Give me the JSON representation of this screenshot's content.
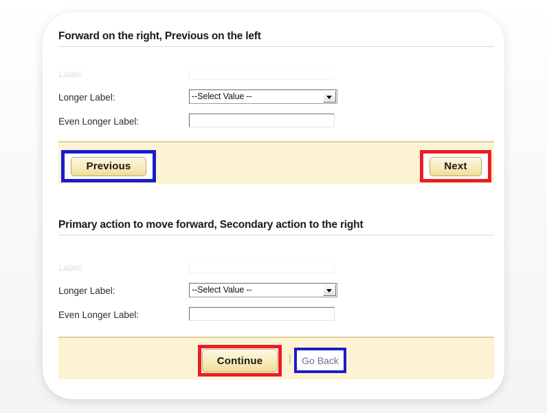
{
  "sections": [
    {
      "heading": "Forward on the right, Previous on the left",
      "fields": [
        {
          "label": "Label:",
          "type": "text",
          "value": "",
          "faded": true
        },
        {
          "label": "Longer Label:",
          "type": "select",
          "value": "--Select Value --"
        },
        {
          "label": "Even Longer Label:",
          "type": "text",
          "value": ""
        }
      ],
      "actions": {
        "left_button": "Previous",
        "right_button": "Next",
        "left_highlight": "blue",
        "right_highlight": "red"
      }
    },
    {
      "heading": "Primary action to move forward, Secondary action to the right",
      "fields": [
        {
          "label": "Label:",
          "type": "text",
          "value": "",
          "faded": true
        },
        {
          "label": "Longer Label:",
          "type": "select",
          "value": "--Select Value --"
        },
        {
          "label": "Even Longer Label:",
          "type": "text",
          "value": ""
        }
      ],
      "actions": {
        "primary_button": "Continue",
        "separator": "|",
        "secondary_link": "Go Back",
        "primary_highlight": "red",
        "secondary_highlight": "blue"
      }
    }
  ],
  "colors": {
    "highlight_red": "#ec1c24",
    "highlight_blue": "#1c1ccc",
    "action_bar": "#fcf3d3",
    "action_bar_border": "#ddd09a",
    "button_face": "#f8ecbd",
    "link": "#6d6d96"
  }
}
